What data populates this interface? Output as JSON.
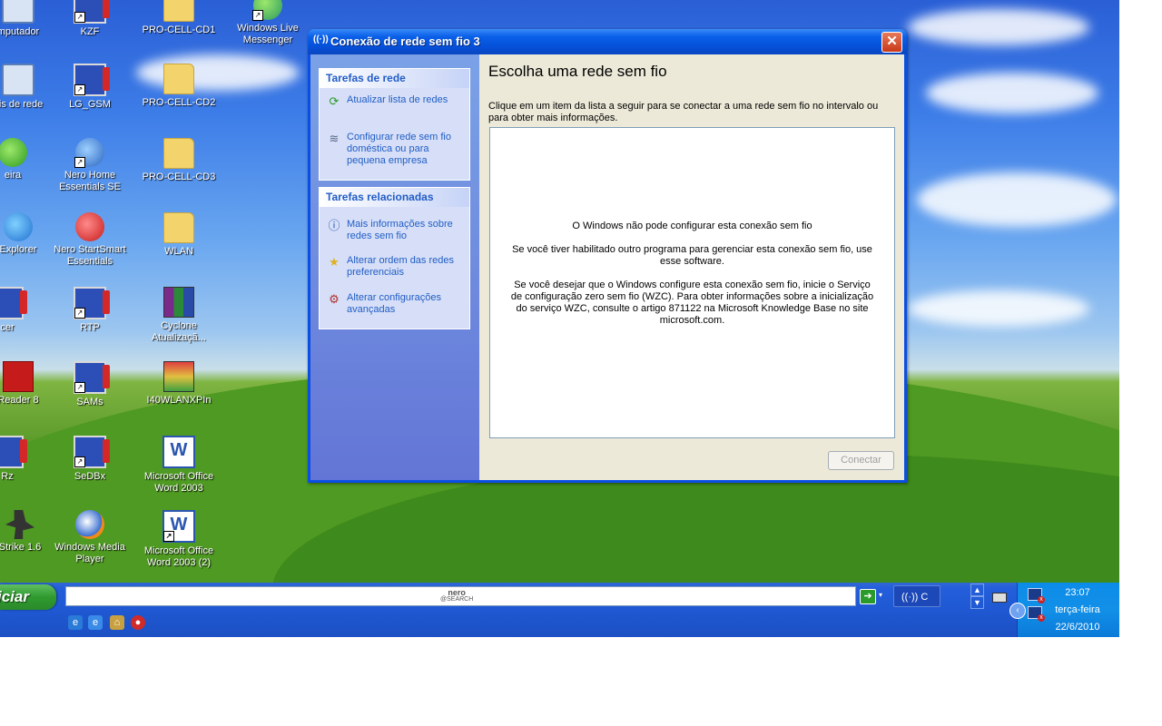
{
  "desktop": {
    "icons": [
      {
        "label": "mputador",
        "glyph": "computer-icon"
      },
      {
        "label": "KZF",
        "glyph": "cellphone-tool-icon"
      },
      {
        "label": "PRO-CELL-CD1",
        "glyph": "folder-icon"
      },
      {
        "label": "Windows Live Messenger",
        "glyph": "messenger-icon"
      },
      {
        "label": "ais de rede",
        "glyph": "network-places-icon"
      },
      {
        "label": "LG_GSM",
        "glyph": "cellphone-tool-icon"
      },
      {
        "label": "PRO-CELL-CD2",
        "glyph": "folder-icon"
      },
      {
        "label": "eira",
        "glyph": "recycle-bin-icon"
      },
      {
        "label": "Nero Home Essentials SE",
        "glyph": "nero-home-icon"
      },
      {
        "label": "PRO-CELL-CD3",
        "glyph": "folder-icon"
      },
      {
        "label": "Explorer",
        "glyph": "internet-explorer-icon"
      },
      {
        "label": "Nero StartSmart Essentials",
        "glyph": "nero-icon"
      },
      {
        "label": "WLAN",
        "glyph": "folder-icon"
      },
      {
        "label": "cer",
        "glyph": "cellphone-tool-icon"
      },
      {
        "label": "RTP",
        "glyph": "cellphone-tool-icon"
      },
      {
        "label": "Cyclone Atualizaçã...",
        "glyph": "winrar-icon"
      },
      {
        "label": "Reader 8",
        "glyph": "adobe-reader-icon"
      },
      {
        "label": "SAMs",
        "glyph": "cellphone-tool-icon"
      },
      {
        "label": "I40WLANXPIn",
        "glyph": "installer-icon"
      },
      {
        "label": "Rz",
        "glyph": "cellphone-tool-icon"
      },
      {
        "label": "SeDBx",
        "glyph": "cellphone-tool-icon"
      },
      {
        "label": "Microsoft Office Word 2003",
        "glyph": "word-icon"
      },
      {
        "label": "Strike 1.6",
        "glyph": "counter-strike-icon"
      },
      {
        "label": "Windows Media Player",
        "glyph": "media-player-icon"
      },
      {
        "label": "Microsoft Office Word 2003 (2)",
        "glyph": "word-icon"
      }
    ]
  },
  "window": {
    "title": "Conexão de rede sem fio 3",
    "title_icon": "((·))",
    "close_glyph": "✕",
    "network_tasks": {
      "heading": "Tarefas de rede",
      "items": [
        {
          "label": "Atualizar lista de redes",
          "icon": "refresh-icon"
        },
        {
          "label": "Configurar rede sem fio doméstica ou para pequena empresa",
          "icon": "wireless-setup-icon"
        }
      ]
    },
    "related_tasks": {
      "heading": "Tarefas relacionadas",
      "items": [
        {
          "label": "Mais informações sobre redes sem fio",
          "icon": "info-icon"
        },
        {
          "label": "Alterar ordem das redes preferenciais",
          "icon": "star-icon"
        },
        {
          "label": "Alterar configurações avançadas",
          "icon": "settings-icon"
        }
      ]
    },
    "main": {
      "title": "Escolha uma rede sem fio",
      "description": "Clique em um item da lista a seguir para se conectar a uma rede sem fio no intervalo ou para obter mais informações.",
      "messages": [
        "O Windows não pode configurar esta conexão sem fio",
        "Se você tiver habilitado outro programa para gerenciar esta conexão sem fio, use esse software.",
        "Se você desejar que o Windows configure esta conexão sem fio, inicie o Serviço de configuração zero sem fio (WZC). Para obter informações sobre a inicialização do serviço WZC, consulte o artigo 871122 na Microsoft Knowledge Base no site microsoft.com."
      ],
      "connect_label": "Conectar"
    }
  },
  "taskbar": {
    "start_label": "iciar",
    "search_logo_top": "nero",
    "search_logo_bottom": "@SEARCH",
    "go_glyph": "➔",
    "drop_glyph": "▾",
    "wireless_task_label": "((·)) C",
    "scroll_up": "▲",
    "scroll_down": "▼",
    "clock_time": "23:07",
    "clock_day": "terça-feira",
    "clock_date": "22/6/2010",
    "quick_launch": [
      "internet-explorer-icon",
      "ie-alt-icon",
      "network-icon",
      "nero-icon"
    ]
  }
}
